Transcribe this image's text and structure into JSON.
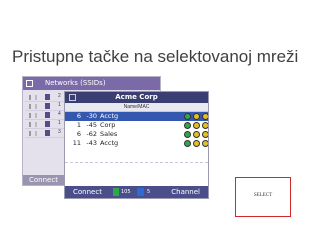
{
  "slide": {
    "title": "Pristupne tačke na selektovanoj mreži"
  },
  "back_window": {
    "title": "Networks (SSIDs)",
    "rows": [
      "2",
      "1",
      "4",
      "1",
      "3"
    ],
    "bottom_label": "Connect"
  },
  "device_window": {
    "title": "Acme Corp",
    "header_label": "Name/MAC",
    "rows": [
      {
        "channel": "6",
        "rssi": "-30",
        "ssid": "Acctg"
      },
      {
        "channel": "1",
        "rssi": "-45",
        "ssid": "Corp"
      },
      {
        "channel": "6",
        "rssi": "-62",
        "ssid": "Sales"
      },
      {
        "channel": "11",
        "rssi": "-43",
        "ssid": "Acctg"
      }
    ],
    "bottom": {
      "connect_label": "Connect",
      "signal_count": "105",
      "network_count": "5",
      "channel_label": "Channel"
    }
  },
  "select_button": {
    "label": "SELECT"
  },
  "colors": {
    "selection": "#3457b0",
    "titlebar": "#3a3e72",
    "highlight_border": "#d12828"
  }
}
